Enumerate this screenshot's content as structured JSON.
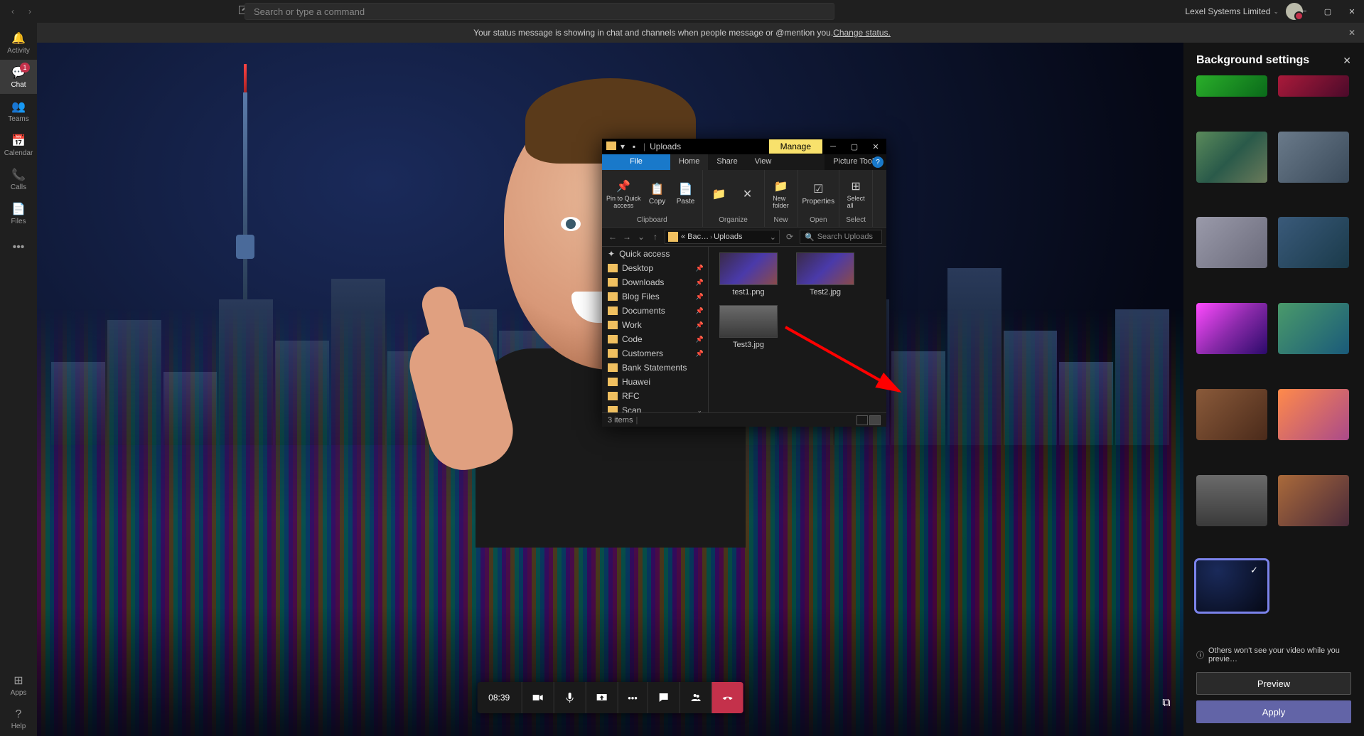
{
  "titlebar": {
    "search_placeholder": "Search or type a command",
    "tenant": "Lexel Systems Limited"
  },
  "banner": {
    "text": "Your status message is showing in chat and channels when people message or @mention you. ",
    "link": "Change status."
  },
  "rail": {
    "items": [
      {
        "label": "Activity",
        "icon": "🔔"
      },
      {
        "label": "Chat",
        "icon": "💬",
        "badge": "1",
        "active": true
      },
      {
        "label": "Teams",
        "icon": "👥"
      },
      {
        "label": "Calendar",
        "icon": "📅"
      },
      {
        "label": "Calls",
        "icon": "📞"
      },
      {
        "label": "Files",
        "icon": "📄"
      }
    ],
    "more": "•••",
    "apps": "Apps",
    "help": "Help"
  },
  "call": {
    "duration": "08:39"
  },
  "explorer": {
    "title": "Uploads",
    "context_tab": "Manage",
    "ribbon_tabs": [
      "File",
      "Home",
      "Share",
      "View"
    ],
    "picture_tools": "Picture Tools",
    "ribbon": {
      "clipboard": {
        "label": "Clipboard",
        "pin": "Pin to Quick\naccess",
        "copy": "Copy",
        "paste": "Paste"
      },
      "organize": {
        "label": "Organize"
      },
      "new": {
        "label": "New",
        "nf": "New\nfolder"
      },
      "open": {
        "label": "Open",
        "props": "Properties"
      },
      "select": {
        "label": "Select",
        "sa": "Select\nall"
      }
    },
    "address": {
      "crumb_mid": "« Bac…",
      "crumb_leaf": "Uploads",
      "search_placeholder": "Search Uploads"
    },
    "tree": {
      "quick": "Quick access",
      "items": [
        "Desktop",
        "Downloads",
        "Blog Files",
        "Documents",
        "Work",
        "Code",
        "Customers",
        "Bank Statements",
        "Huawei",
        "RFC",
        "Scan"
      ]
    },
    "files": [
      {
        "name": "test1.png",
        "t": "city"
      },
      {
        "name": "Test2.jpg",
        "t": "city"
      },
      {
        "name": "Test3.jpg",
        "t": "room"
      }
    ],
    "status": "3 items"
  },
  "bgpanel": {
    "title": "Background settings",
    "thumbs": [
      {
        "g": "linear-gradient(135deg,#2aae2a,#0a6a1a)"
      },
      {
        "g": "linear-gradient(135deg,#aa1a3a,#4a0a2a)"
      },
      {
        "g": "linear-gradient(135deg,#5a8a5a,#2a5a4a,#6a7a5a)"
      },
      {
        "g": "linear-gradient(135deg,#6a7a8a,#3a4a5a)"
      },
      {
        "g": "linear-gradient(135deg,#9a9aaa,#6a6a7a)"
      },
      {
        "g": "linear-gradient(135deg,#3a5a7a,#1a3a4a)"
      },
      {
        "g": "linear-gradient(135deg,#ff4aff,#8a2aaa,#2a0a6a)"
      },
      {
        "g": "linear-gradient(135deg,#4a9a6a,#1a5a7a)"
      },
      {
        "g": "linear-gradient(135deg,#8a5a3a,#4a2a1a)"
      },
      {
        "g": "linear-gradient(135deg,#ff8a4a,#aa4a8a)"
      },
      {
        "g": "linear-gradient(180deg,#6a6a6a,#3a3a3a)",
        "arrow": true
      },
      {
        "g": "linear-gradient(135deg,#aa6a3a,#4a2a3a)"
      },
      {
        "g": "radial-gradient(circle at 30% 20%,#1a2a5a,#050815)",
        "sel": true
      }
    ],
    "note": "Others won't see your video while you previe…",
    "preview": "Preview",
    "apply": "Apply"
  }
}
